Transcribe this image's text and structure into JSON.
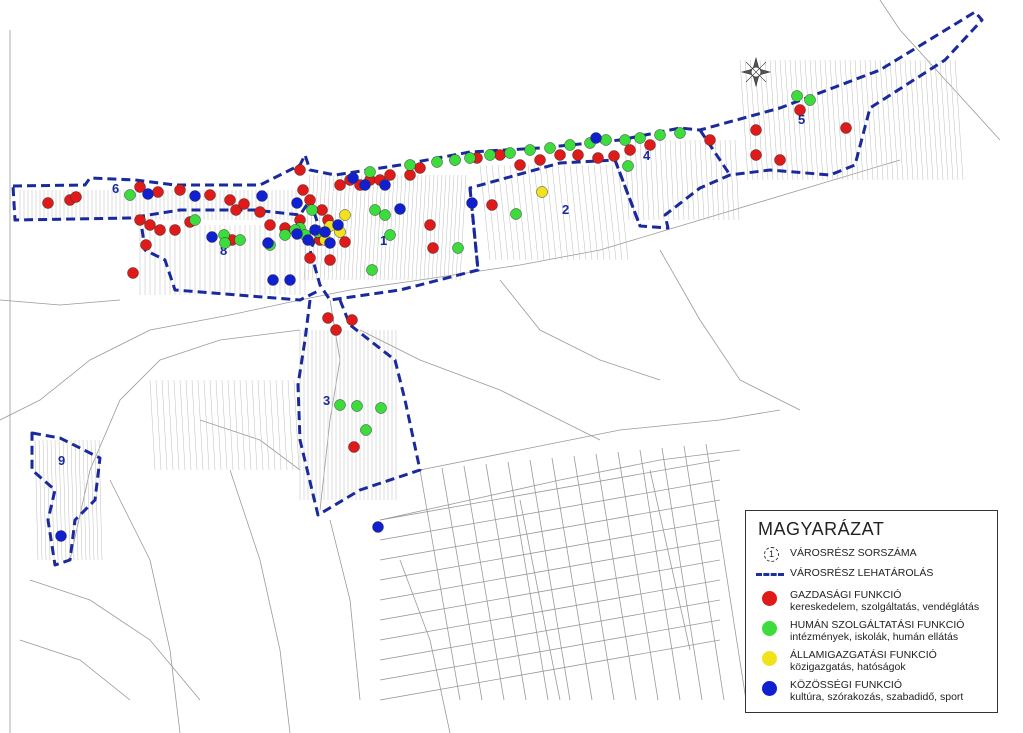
{
  "colors": {
    "boundary": "#1a2a9c",
    "gazdasagi": "#e01919",
    "human": "#3ddc3d",
    "allamigazgatasi": "#f2e21b",
    "kozossegi": "#1020d0",
    "street": "#8a8a8a",
    "parcel": "#c8c8c8"
  },
  "district_labels": [
    "1",
    "2",
    "3",
    "4",
    "5",
    "6",
    "8",
    "9"
  ],
  "legend": {
    "title": "MAGYARÁZAT",
    "district_number_symbol": "1",
    "district_number_label": "VÁROSRÉSZ SORSZÁMA",
    "boundary_label": "VÁROSRÉSZ LEHATÁROLÁS",
    "gazdasagi": {
      "title": "GAZDASÁGI FUNKCIÓ",
      "desc": "kereskedelem, szolgáltatás, vendéglátás"
    },
    "human": {
      "title": "HUMÁN SZOLGÁLTATÁSI FUNKCIÓ",
      "desc": "intézmények, iskolák, humán ellátás"
    },
    "allamigazgatasi": {
      "title": "ÁLLAMIGAZGATÁSI FUNKCIÓ",
      "desc": "közigazgatás, hatóságok"
    },
    "kozossegi": {
      "title": "KÖZÖSSÉGI FUNKCIÓ",
      "desc": "kultúra, szórakozás, szabadidő, sport"
    }
  }
}
